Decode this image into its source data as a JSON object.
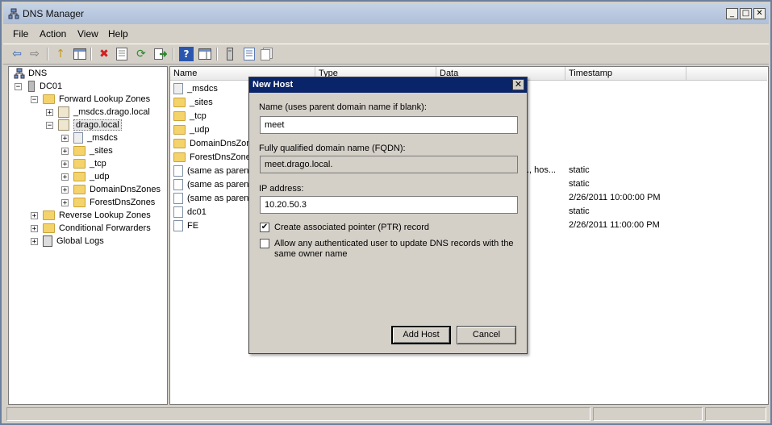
{
  "window": {
    "title": "DNS Manager",
    "minimize_label": "_",
    "maximize_label": "□",
    "close_label": "✕"
  },
  "menu": [
    "File",
    "Action",
    "View",
    "Help"
  ],
  "toolbar": {
    "buttons": [
      "back-arrow-icon",
      "forward-arrow-icon",
      "up-folder-icon",
      "show-hide-console-tree-icon",
      "delete-icon",
      "properties-icon",
      "refresh-icon",
      "export-list-icon",
      "help-icon",
      "show-hide-action-pane-icon",
      "update-server-data-files-icon",
      "new-record-icon",
      "new-other-record-icon"
    ],
    "glyphs": {
      "back": "⇦",
      "forward": "⇨",
      "up": "↑",
      "delete": "✖",
      "help": "?",
      "refresh": "⟳"
    }
  },
  "tree": {
    "nodes": [
      {
        "label": "DNS"
      },
      {
        "label": "DC01"
      },
      {
        "label": "Forward Lookup Zones"
      },
      {
        "label": "_msdcs.drago.local"
      },
      {
        "label": "drago.local"
      },
      {
        "label": "_msdcs"
      },
      {
        "label": "_sites"
      },
      {
        "label": "_tcp"
      },
      {
        "label": "_udp"
      },
      {
        "label": "DomainDnsZones"
      },
      {
        "label": "ForestDnsZones"
      },
      {
        "label": "Reverse Lookup Zones"
      },
      {
        "label": "Conditional Forwarders"
      },
      {
        "label": "Global Logs"
      }
    ],
    "expander_plus": "+",
    "expander_minus": "−"
  },
  "list": {
    "columns": [
      "Name",
      "Type",
      "Data",
      "Timestamp"
    ],
    "rows": [
      {
        "name": "_msdcs",
        "data": "",
        "timestamp": ""
      },
      {
        "name": "_sites",
        "data": "",
        "timestamp": ""
      },
      {
        "name": "_tcp",
        "data": "",
        "timestamp": ""
      },
      {
        "name": "_udp",
        "data": "",
        "timestamp": ""
      },
      {
        "name": "DomainDnsZone",
        "data": "",
        "timestamp": ""
      },
      {
        "name": "ForestDnsZone",
        "data": "",
        "timestamp": ""
      },
      {
        "name": "(same as parent",
        "data": "., hos...",
        "timestamp": "static"
      },
      {
        "name": "(same as parent",
        "data": "",
        "timestamp": "static"
      },
      {
        "name": "(same as parent",
        "data": "",
        "timestamp": "2/26/2011 10:00:00 PM"
      },
      {
        "name": "dc01",
        "data": "",
        "timestamp": "static"
      },
      {
        "name": "FE",
        "data": "",
        "timestamp": "2/26/2011 11:00:00 PM"
      }
    ]
  },
  "dialog": {
    "title": "New Host",
    "close_label": "✕",
    "name_label": "Name (uses parent domain name if blank):",
    "name_value": "meet",
    "fqdn_label": "Fully qualified domain name (FQDN):",
    "fqdn_value": "meet.drago.local.",
    "ip_label": "IP address:",
    "ip_value": "10.20.50.3",
    "ptr_label": "Create associated pointer (PTR) record",
    "ptr_checked": true,
    "ptr_mark": "✔",
    "update_label": "Allow any authenticated user to update DNS records with the same owner name",
    "update_checked": false,
    "add_host_label": "Add Host",
    "cancel_label": "Cancel"
  }
}
